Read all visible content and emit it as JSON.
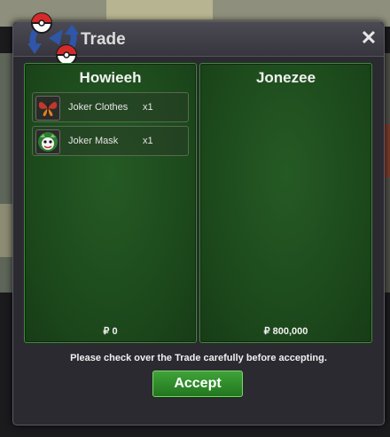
{
  "window": {
    "title": "Trade"
  },
  "left_panel": {
    "name": "Howieeh",
    "money": "₽ 0",
    "items": [
      {
        "name": "Joker Clothes",
        "qty": "x1",
        "icon": "butterfly-icon"
      },
      {
        "name": "Joker Mask",
        "qty": "x1",
        "icon": "joker-mask-icon"
      }
    ]
  },
  "right_panel": {
    "name": "Jonezee",
    "money": "₽ 800,000",
    "items": []
  },
  "message": "Please check over the Trade carefully before accepting.",
  "accept_label": "Accept",
  "colors": {
    "panel_green": "#1d4a1c",
    "accept_green": "#2f8c2a",
    "window_bg": "#2b2a31"
  }
}
